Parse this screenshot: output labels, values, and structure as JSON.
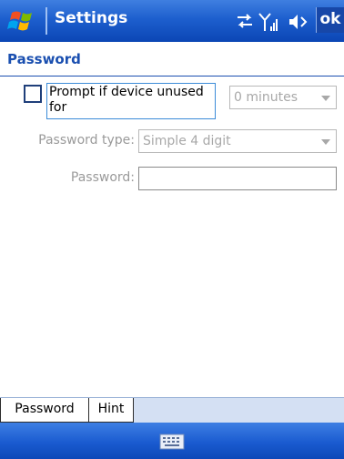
{
  "titlebar": {
    "title": "Settings",
    "ok_label": "ok",
    "icons": [
      "windows-start-icon",
      "connectivity-icon",
      "signal-strength-icon",
      "volume-icon"
    ]
  },
  "page": {
    "title": "Password"
  },
  "form": {
    "prompt_label": "Prompt if device unused for",
    "prompt_checked": false,
    "minutes_value": "0 minutes",
    "password_type_label": "Password type:",
    "password_type_value": "Simple 4 digit",
    "password_label": "Password:",
    "password_value": ""
  },
  "tabs": [
    {
      "label": "Password",
      "active": true
    },
    {
      "label": "Hint",
      "active": false
    }
  ],
  "bottombar": {
    "icons": [
      "keyboard-icon"
    ]
  },
  "colors": {
    "titlebar_blue": "#1d5fce",
    "header_text": "#1a4fb0",
    "disabled_text": "#a8a8a8",
    "tab_strip": "#d4e0f3"
  }
}
